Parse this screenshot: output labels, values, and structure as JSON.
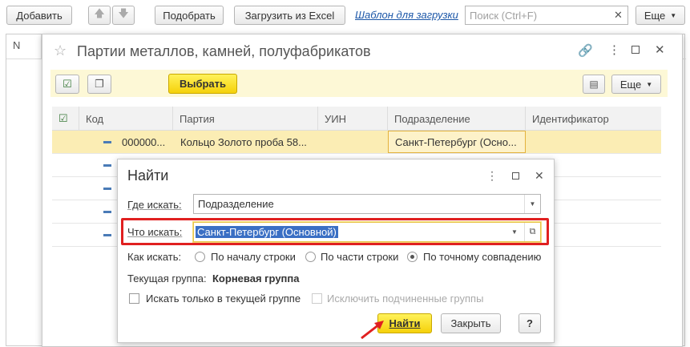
{
  "toolbar": {
    "add_label": "Добавить",
    "select_label": "Подобрать",
    "load_excel_label": "Загрузить из Excel",
    "template_link": "Шаблон для загрузки",
    "search_placeholder": "Поиск (Ctrl+F)",
    "more_label": "Еще"
  },
  "background_table": {
    "first_col_header": "N"
  },
  "parties_window": {
    "title": "Партии металлов, камней, полуфабрикатов",
    "select_button": "Выбрать",
    "more_label": "Еще",
    "columns": [
      "Код",
      "Партия",
      "УИН",
      "Подразделение",
      "Идентификатор"
    ],
    "rows": [
      {
        "code": "000000...",
        "party": "Кольцо Золото проба 58...",
        "uin": "",
        "division": "Санкт-Петербург (Осно...",
        "identifier": "",
        "selected": true
      },
      {
        "code": "",
        "party": "",
        "uin": "",
        "division": "",
        "identifier": ""
      },
      {
        "code": "",
        "party": "",
        "uin": "",
        "division": "",
        "identifier": ""
      },
      {
        "code": "",
        "party": "",
        "uin": "",
        "division": "",
        "identifier": ""
      },
      {
        "code": "",
        "party": "",
        "uin": "",
        "division": "",
        "identifier": ""
      }
    ]
  },
  "find_dialog": {
    "title": "Найти",
    "where_label": "Где искать:",
    "where_value": "Подразделение",
    "what_label": "Что искать:",
    "what_value": "Санкт-Петербург (Основной)",
    "how_label": "Как искать:",
    "how_options": [
      "По началу строки",
      "По части строки",
      "По точному совпадению"
    ],
    "how_selected": 2,
    "current_group_label": "Текущая группа:",
    "current_group_value": "Корневая группа",
    "only_current_group_label": "Искать только в текущей группе",
    "exclude_subgroups_label": "Исключить подчиненные группы",
    "find_button": "Найти",
    "close_button": "Закрыть",
    "help_button": "?"
  },
  "colors": {
    "accent_yellow": "#f5d10a",
    "selected_row": "#fbedb4",
    "highlight_red": "#e02020",
    "link_blue": "#1c57a8"
  }
}
